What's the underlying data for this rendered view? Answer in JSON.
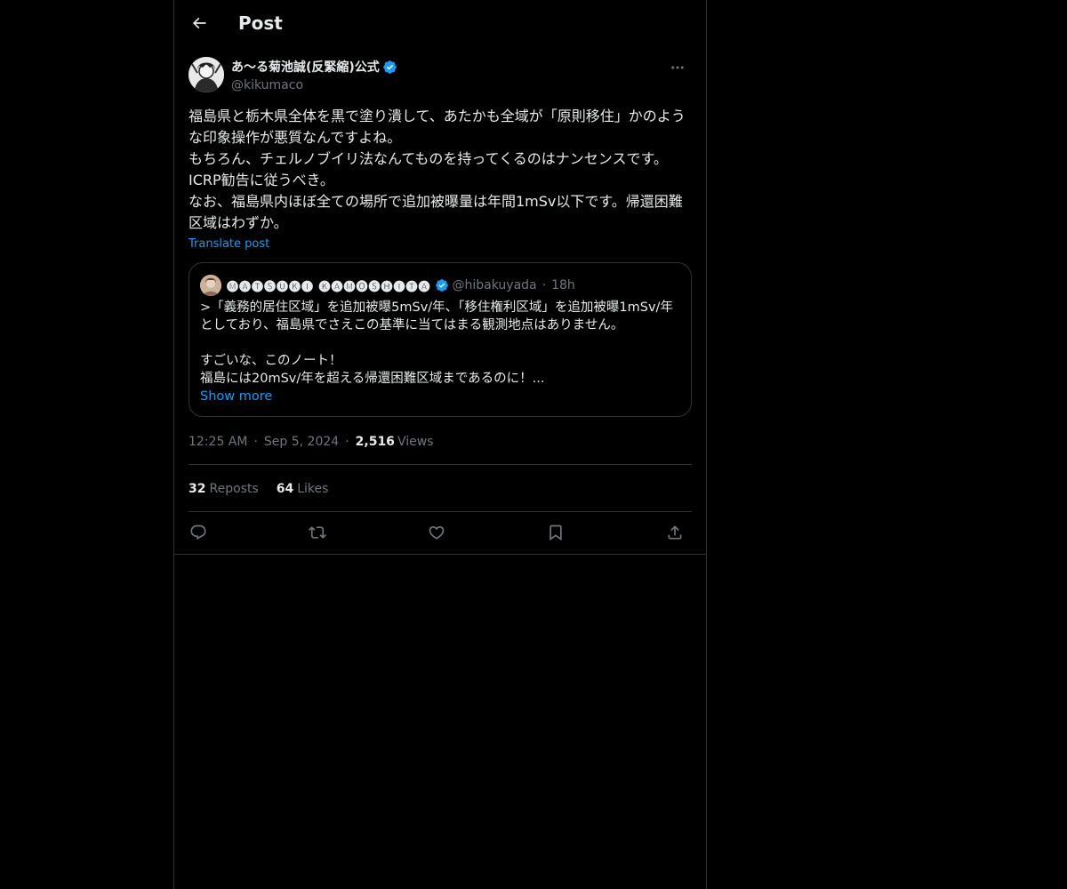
{
  "topbar": {
    "title": "Post"
  },
  "post": {
    "display_name": "あ〜る菊池誠(反緊縮)公式",
    "handle": "@kikumaco",
    "text": "福島県と栃木県全体を黒で塗り潰して、あたかも全域が「原則移住」かのような印象操作が悪質なんですよね。\nもちろん、チェルノブイリ法なんてものを持ってくるのはナンセンスです。ICRP勧告に従うべき。\nなお、福島県内ほぼ全ての場所で追加被曝量は年間1mSv以下です。帰還困難区域はわずか。",
    "translate_label": "Translate post",
    "time": "12:25 AM",
    "date": "Sep 5, 2024",
    "views_count": "2,516",
    "views_label": "Views",
    "reposts_count": "32",
    "reposts_label": "Reposts",
    "likes_count": "64",
    "likes_label": "Likes",
    "separator": "·"
  },
  "quote": {
    "display_name": "🅜🅐🅣🅢🅤🅚🅘 🅚🅐🅜🅞🅢🅗🅘🅣🅐",
    "handle": "@hibakuyada",
    "separator": "·",
    "time": "18h",
    "text": ">「義務的居住区域」を追加被曝5mSv/年、「移住権利区域」を追加被曝1mSv/年としており、福島県でさえこの基準に当てはまる観測地点はありません。\n\nすごいな、このノート！\n福島には20mSv/年を超える帰還困難区域まであるのに！...",
    "show_more": "Show more"
  },
  "colors": {
    "background": "#000000",
    "text": "#e7e9ea",
    "secondary": "#71767b",
    "accent": "#1d9bf0",
    "border": "#2f3336"
  },
  "icons": {
    "back": "arrow-left-icon",
    "verified": "verified-badge-icon",
    "more": "more-horizontal-icon",
    "reply": "reply-icon",
    "repost": "repost-icon",
    "like": "heart-icon",
    "bookmark": "bookmark-icon",
    "share": "share-icon"
  }
}
